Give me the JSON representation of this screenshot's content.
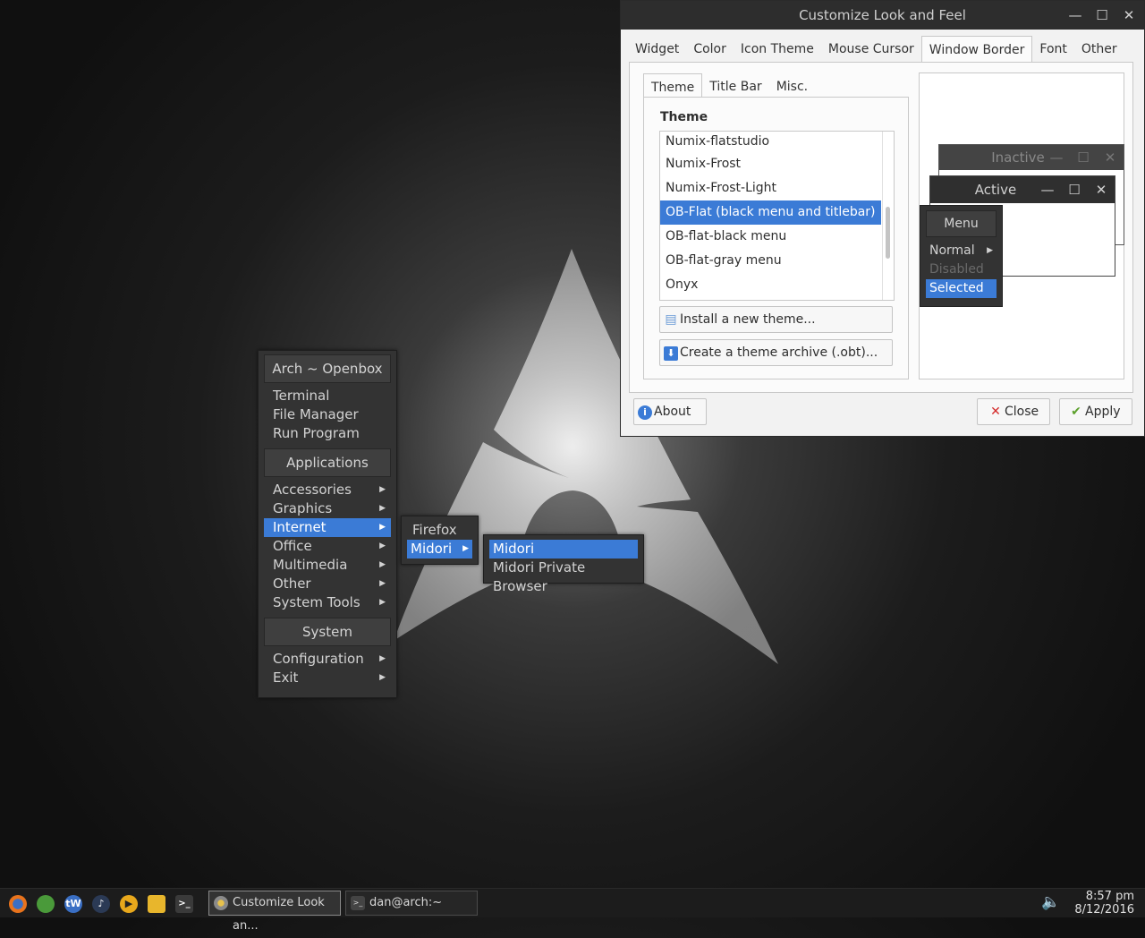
{
  "colors": {
    "accent": "#3b7bd6",
    "menu_bg": "#333333",
    "window_bg": "#f2f2f2",
    "titlebar_bg": "#2d2d2d"
  },
  "desktop": {
    "logo": "arch-linux-logo"
  },
  "root_menu": {
    "header1": "Arch ~ Openbox",
    "items1": [
      "Terminal",
      "File Manager",
      "Run Program"
    ],
    "header2": "Applications",
    "items2": [
      "Accessories",
      "Graphics",
      "Internet",
      "Office",
      "Multimedia",
      "Other",
      "System Tools"
    ],
    "header3": "System",
    "items3": [
      "Configuration",
      "Exit"
    ]
  },
  "internet_menu": {
    "items": [
      "Firefox",
      "Midori"
    ]
  },
  "midori_menu": {
    "items": [
      "Midori",
      "Midori Private Browser"
    ]
  },
  "window": {
    "title": "Customize Look and Feel",
    "controls": {
      "minimize": "—",
      "maximize": "☐",
      "close": "✕"
    },
    "tabs": [
      "Widget",
      "Color",
      "Icon Theme",
      "Mouse Cursor",
      "Window Border",
      "Font",
      "Other"
    ],
    "active_tab": "Window Border",
    "subtabs": [
      "Theme",
      "Title Bar",
      "Misc."
    ],
    "section_title": "Theme",
    "themes": [
      "Numix-flatstudio",
      "Numix-Frost",
      "Numix-Frost-Light",
      "OB-Flat (black menu and titlebar)",
      "OB-flat-black menu",
      "OB-flat-gray menu",
      "Onyx"
    ],
    "selected_theme": "OB-Flat (black menu and titlebar)",
    "install_button": "Install a new theme...",
    "archive_button": "Create a theme archive (.obt)...",
    "about_button": "About",
    "close_button": "Close",
    "apply_button": "Apply",
    "preview": {
      "inactive": "Inactive",
      "active": "Active",
      "menu": "Menu",
      "normal": "Normal",
      "disabled": "Disabled",
      "selected": "Selected"
    }
  },
  "taskbar": {
    "launchers": [
      "firefox-icon",
      "web-browser-icon",
      "tw-icon",
      "music-icon",
      "media-player-icon",
      "file-manager-icon",
      "terminal-icon"
    ],
    "tw_label": "tW",
    "tasks": [
      "Customize Look an...",
      "dan@arch:~"
    ],
    "time": "8:57 pm",
    "date": "8/12/2016"
  }
}
